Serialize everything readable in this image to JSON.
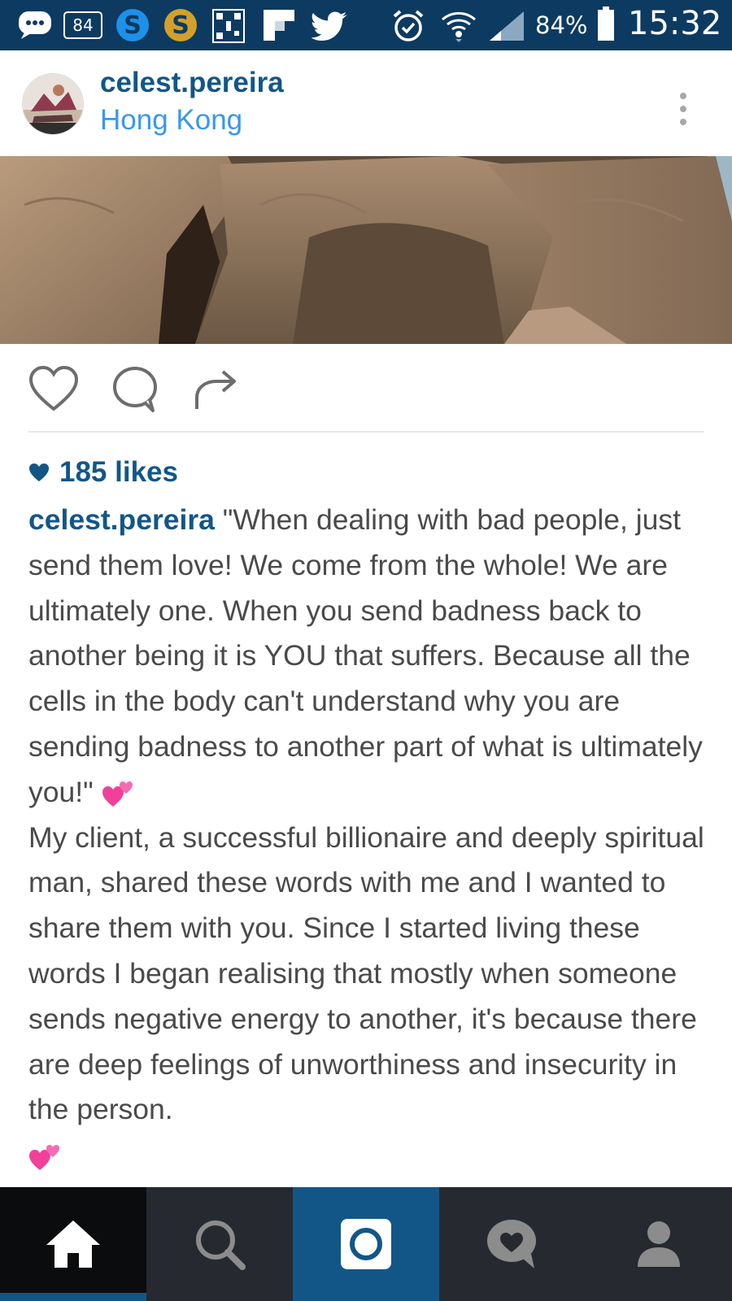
{
  "status_bar": {
    "notification_count": "84",
    "battery_percent": "84%",
    "time": "15:32",
    "icons": [
      "message-icon",
      "notification-count-icon",
      "skype-icon",
      "skype-gold-icon",
      "qr-icon",
      "flipboard-icon",
      "twitter-icon",
      "alarm-icon",
      "wifi-icon",
      "signal-icon",
      "battery-icon"
    ]
  },
  "post": {
    "username": "celest.pereira",
    "location": "Hong Kong",
    "likes": "185 likes",
    "caption": {
      "username": "celest.pereira",
      "quote": " \"When dealing with bad people, just send them love! We come from the whole! We are ultimately one. When you send badness back to another being it is YOU that suffers. Because all the cells in the body can't understand why you are sending badness to another part of what is ultimately you!\"",
      "body": "My client, a successful billionaire and deeply spiritual man, shared these words with me and I wanted to share them with you. Since I started living these words I began realising that mostly when someone sends negative energy to another, it's because there are deep feelings of unworthiness and insecurity in the person."
    }
  },
  "bottom_nav": {
    "items": [
      "home-icon",
      "search-icon",
      "camera-icon",
      "activity-icon",
      "profile-icon"
    ],
    "active": "home-icon"
  },
  "colors": {
    "status_bar": "#0d3a61",
    "brand_blue": "#125688",
    "location_blue": "#3897f0",
    "caption_text": "#4a4a4a",
    "nav_bg": "#262a30"
  }
}
